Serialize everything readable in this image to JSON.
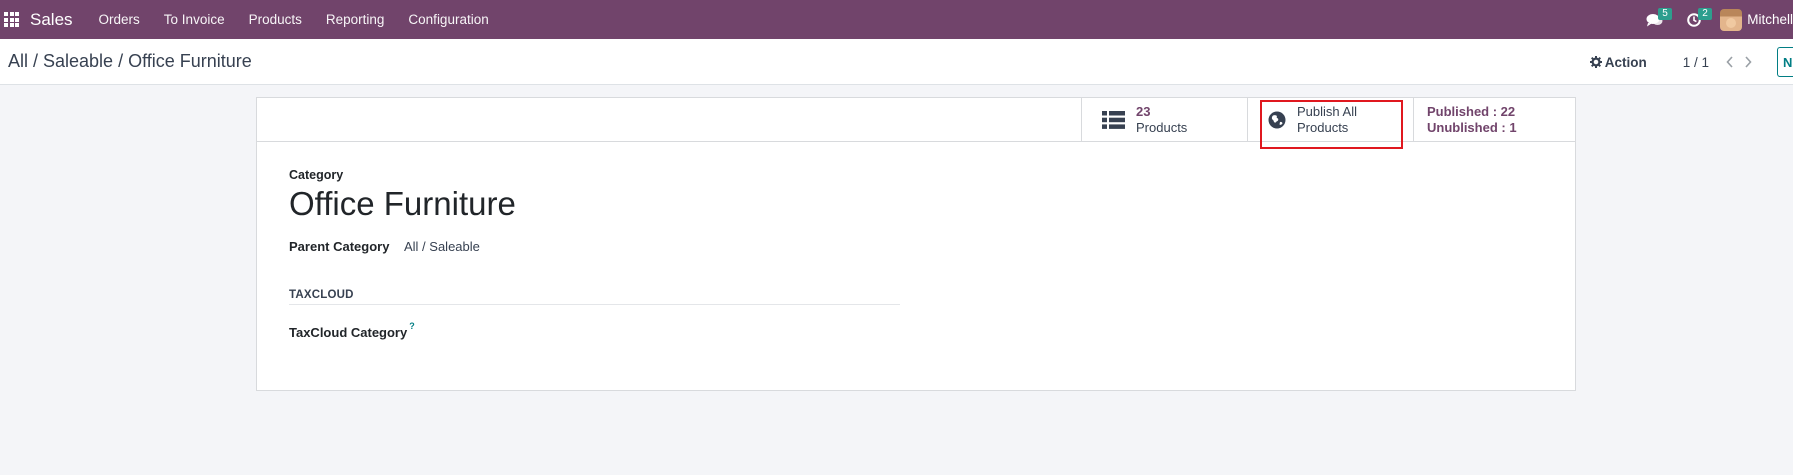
{
  "navbar": {
    "app_name": "Sales",
    "menu": [
      "Orders",
      "To Invoice",
      "Products",
      "Reporting",
      "Configuration"
    ],
    "messages_count": "5",
    "activities_count": "2",
    "user_name": "Mitchell"
  },
  "control_panel": {
    "breadcrumb": [
      "All / Saleable / Office Furniture"
    ],
    "action_label": "Action",
    "pager_value": "1 / 1",
    "new_label": "N"
  },
  "button_box": {
    "products_count": "23",
    "products_label": "Products",
    "publish_line1": "Publish All",
    "publish_line2": "Products",
    "published_text": "Published : 22",
    "unpublished_text": "Unublished : 1"
  },
  "form": {
    "caption": "Category",
    "title": "Office Furniture",
    "parent_label": "Parent Category",
    "parent_value": "All / Saleable",
    "group_title": "TAXCLOUD",
    "taxcloud_label": "TaxCloud Category",
    "help_mark": "?"
  },
  "colors": {
    "brand": "#71446b",
    "accent": "#017e84",
    "highlight": "#e0181f",
    "badge": "#2d9e8e"
  }
}
